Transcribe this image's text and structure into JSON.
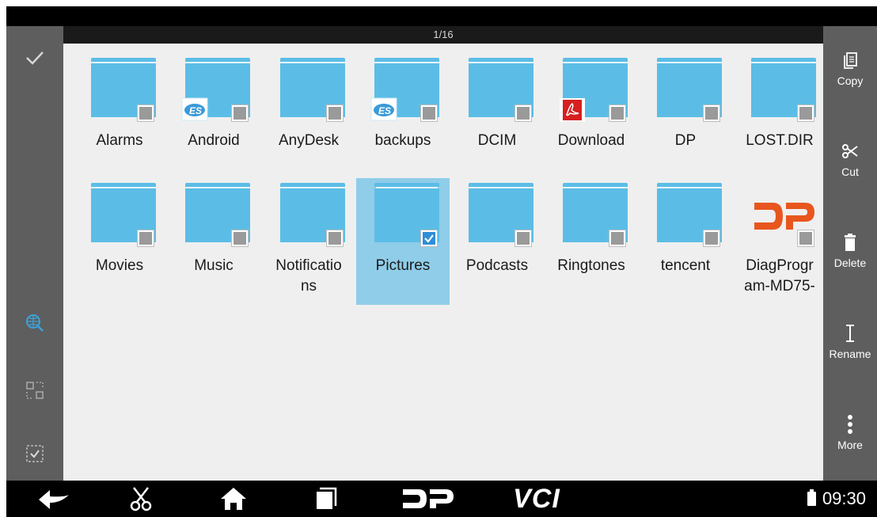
{
  "page_counter": "1/16",
  "left_rail": {
    "items": [
      {
        "name": "confirm",
        "icon": "check-icon"
      },
      {
        "name": "network-search",
        "icon": "globe-search-icon"
      },
      {
        "name": "scan",
        "icon": "scan-icon"
      },
      {
        "name": "select-all",
        "icon": "select-box-icon"
      }
    ]
  },
  "actions": {
    "copy": "Copy",
    "cut": "Cut",
    "delete": "Delete",
    "rename": "Rename",
    "more": "More"
  },
  "folders": [
    {
      "name": "Alarms",
      "checked": false,
      "badge": null
    },
    {
      "name": "Android",
      "checked": false,
      "badge": "es-app-icon"
    },
    {
      "name": "AnyDesk",
      "checked": false,
      "badge": null
    },
    {
      "name": "backups",
      "checked": false,
      "badge": "es-app-icon"
    },
    {
      "name": "DCIM",
      "checked": false,
      "badge": null
    },
    {
      "name": "Download",
      "checked": false,
      "badge": "pdf-icon"
    },
    {
      "name": "DP",
      "checked": false,
      "badge": null
    },
    {
      "name": "LOST.DIR",
      "checked": false,
      "badge": null
    },
    {
      "name": "Movies",
      "checked": false,
      "badge": null
    },
    {
      "name": "Music",
      "checked": false,
      "badge": null
    },
    {
      "name": "Notificatio\nns",
      "checked": false,
      "badge": null
    },
    {
      "name": "Pictures",
      "checked": true,
      "badge": null
    },
    {
      "name": "Podcasts",
      "checked": false,
      "badge": null
    },
    {
      "name": "Ringtones",
      "checked": false,
      "badge": null
    },
    {
      "name": "tencent",
      "checked": false,
      "badge": null
    },
    {
      "name": "DiagProgr\nam-MD75-",
      "checked": false,
      "badge": "dp-logo"
    }
  ],
  "nav_bar": {
    "items": [
      "back-icon",
      "scissors-icon",
      "home-icon",
      "recents-icon",
      "dp-logo",
      "vci-logo"
    ],
    "dp_text": "DP",
    "vci_text": "VCI",
    "time": "09:30"
  },
  "colors": {
    "folder": "#5bbde6",
    "selection": "#8fcde8",
    "rail": "#5e5e5e",
    "accent_orange": "#e8561e",
    "check_blue": "#2f8ed6"
  }
}
